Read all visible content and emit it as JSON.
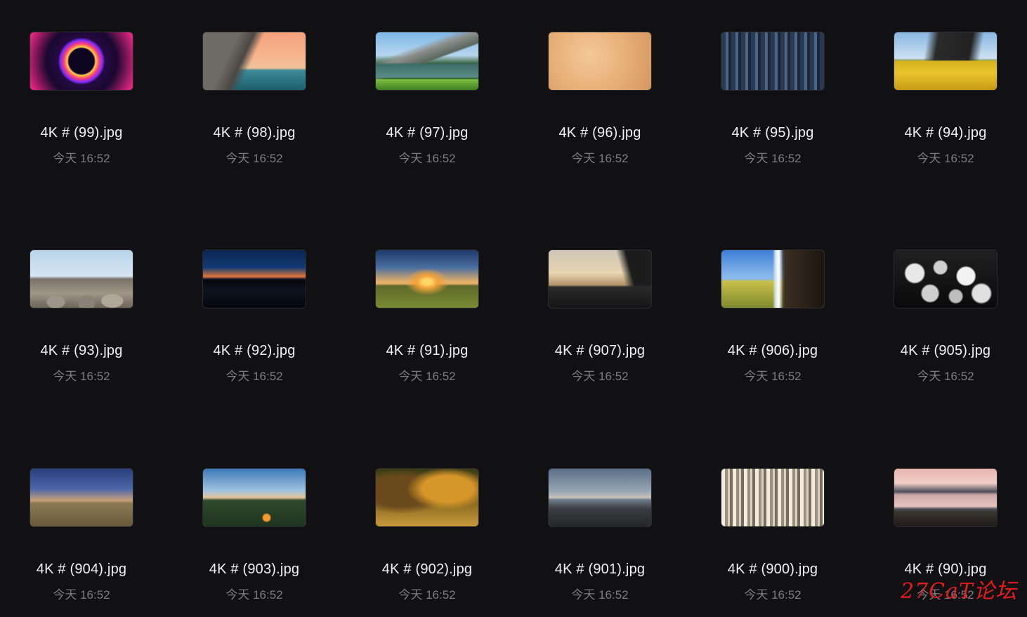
{
  "files": [
    {
      "name": "4K # (99).jpg",
      "time": "今天 16:52",
      "thumb": "orb"
    },
    {
      "name": "4K # (98).jpg",
      "time": "今天 16:52",
      "thumb": "cliff-sunset"
    },
    {
      "name": "4K # (97).jpg",
      "time": "今天 16:52",
      "thumb": "mountain-lake"
    },
    {
      "name": "4K # (96).jpg",
      "time": "今天 16:52",
      "thumb": "sand"
    },
    {
      "name": "4K # (95).jpg",
      "time": "今天 16:52",
      "thumb": "city"
    },
    {
      "name": "4K # (94).jpg",
      "time": "今天 16:52",
      "thumb": "road"
    },
    {
      "name": "4K # (93).jpg",
      "time": "今天 16:52",
      "thumb": "stones"
    },
    {
      "name": "4K # (92).jpg",
      "time": "今天 16:52",
      "thumb": "night-lake"
    },
    {
      "name": "4K # (91).jpg",
      "time": "今天 16:52",
      "thumb": "sunset-field"
    },
    {
      "name": "4K # (907).jpg",
      "time": "今天 16:52",
      "thumb": "mountain-dusk"
    },
    {
      "name": "4K # (906).jpg",
      "time": "今天 16:52",
      "thumb": "waterfall"
    },
    {
      "name": "4K # (905).jpg",
      "time": "今天 16:52",
      "thumb": "jellyfish"
    },
    {
      "name": "4K # (904).jpg",
      "time": "今天 16:52",
      "thumb": "desert-dusk"
    },
    {
      "name": "4K # (903).jpg",
      "time": "今天 16:52",
      "thumb": "river-camp"
    },
    {
      "name": "4K # (902).jpg",
      "time": "今天 16:52",
      "thumb": "autumn-trees"
    },
    {
      "name": "4K # (901).jpg",
      "time": "今天 16:52",
      "thumb": "beach"
    },
    {
      "name": "4K # (900).jpg",
      "time": "今天 16:52",
      "thumb": "birch-forest"
    },
    {
      "name": "4K # (90).jpg",
      "time": "今天 16:52",
      "thumb": "pink-lake"
    }
  ],
  "watermark": "27CaT论坛"
}
